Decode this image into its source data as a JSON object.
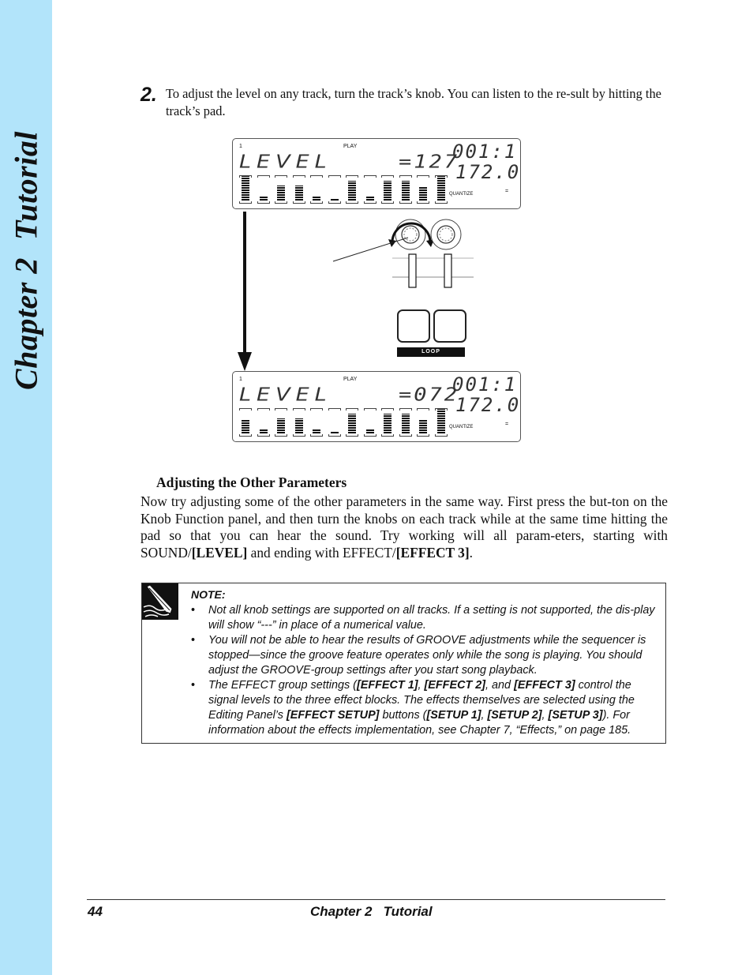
{
  "sidebar": {
    "chapter": "Chapter 2",
    "title": "Tutorial",
    "color": "#b2e4fa"
  },
  "step": {
    "number": "2.",
    "text": "To adjust the level on any track, turn the track’s knob. You can listen to the re-sult by hitting the track’s pad."
  },
  "displays": [
    {
      "track": "1",
      "mode": "PLAY",
      "parameter": "LEVEL",
      "value": "127",
      "position": "001:1",
      "tempo": "172.0",
      "quantize_label": "QUANTIZE",
      "quantize_value": "=",
      "meter_levels": [
        1.0,
        0.2,
        0.6,
        0.6,
        0.2,
        0.1,
        0.8,
        0.2,
        0.8,
        0.8,
        0.55,
        1.0
      ]
    },
    {
      "track": "1",
      "mode": "PLAY",
      "parameter": "LEVEL",
      "value": "072",
      "position": "001:1",
      "tempo": "172.0",
      "quantize_label": "QUANTIZE",
      "quantize_value": "=",
      "meter_levels": [
        0.55,
        0.2,
        0.6,
        0.6,
        0.2,
        0.1,
        0.8,
        0.2,
        0.8,
        0.8,
        0.55,
        1.0
      ]
    }
  ],
  "panel": {
    "loop_label": "LOOP"
  },
  "section": {
    "heading": "Adjusting the Other Parameters",
    "paragraph_parts": [
      "Now try adjusting some of the other parameters in the same way. First press the but-ton on the Knob Function panel, and then turn the knobs on each track while at the same time hitting the pad so that you can hear the sound. Try working will all param-eters, starting with SOUND/",
      "[LEVEL]",
      " and ending with EFFECT/",
      "[EFFECT 3]",
      "."
    ]
  },
  "note": {
    "icon": "pencil-icon",
    "title": "NOTE:",
    "bullet": "•",
    "items": [
      {
        "parts": [
          "Not all knob settings are supported on all tracks. If a setting is not supported, the dis-play will show “---” in place of a numerical value."
        ]
      },
      {
        "parts": [
          "You will not be able to hear the results of GROOVE adjustments while the sequencer is stopped—since the groove feature operates only while the song is playing. You should adjust the GROOVE-group settings after you start song playback."
        ]
      },
      {
        "parts": [
          "The EFFECT group settings (",
          "[EFFECT 1]",
          ", ",
          "[EFFECT 2]",
          ", and ",
          "[EFFECT 3]",
          " control the signal levels to the three effect blocks. The effects themselves are selected using the Editing Panel’s ",
          "[EFFECT SETUP]",
          " buttons (",
          "[SETUP 1]",
          ", ",
          "[SETUP 2]",
          ", ",
          "[SETUP 3]",
          "). For information about the effects implementation, see Chapter 7, “Effects,” on page 185."
        ]
      }
    ]
  },
  "footer": {
    "page_number": "44",
    "title": "Chapter 2   Tutorial"
  }
}
